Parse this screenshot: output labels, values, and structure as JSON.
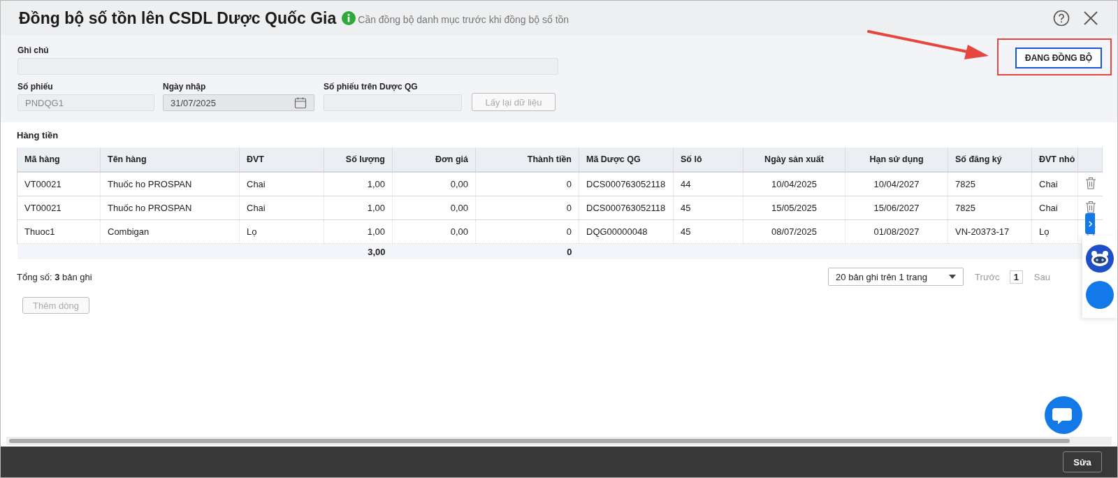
{
  "window": {
    "title": "Đồng bộ số tồn lên CSDL Dược Quốc Gia",
    "hint": "Cần đồng bộ danh mục trước khi đồng bộ số tồn"
  },
  "sync_button": {
    "label": "ĐANG ĐỒNG BỘ"
  },
  "form": {
    "note": {
      "label": "Ghi chú"
    },
    "fields": [
      {
        "kind": "text",
        "label": "Số phiếu",
        "value": "PNDQG1",
        "disabled": true
      },
      {
        "kind": "date",
        "label": "Ngày nhập",
        "value": "31/07/2025",
        "disabled": false
      },
      {
        "kind": "text",
        "label": "Số phiếu trên Dược QG",
        "disabled": true
      }
    ],
    "reload_button": {
      "label": "Lấy lại dữ liệu",
      "disabled": true
    }
  },
  "section_title": "Hàng tiền",
  "table": {
    "columns": [
      "Mã hàng",
      "Tên hàng",
      "ĐVT",
      "Số lượng",
      "Đơn giá",
      "Thành tiền",
      "Mã Dược QG",
      "Số lô",
      "Ngày sản xuất",
      "Hạn sử dụng",
      "Số đăng ký",
      "ĐVT nhỏ"
    ],
    "rows": [
      [
        "VT00021",
        "Thuốc ho PROSPAN",
        "Chai",
        "1,00",
        "0,00",
        "0",
        "DCS000763052118",
        "44",
        "10/04/2025",
        "10/04/2027",
        "7825",
        "Chai"
      ],
      [
        "VT00021",
        "Thuốc ho PROSPAN",
        "Chai",
        "1,00",
        "0,00",
        "0",
        "DCS000763052118",
        "45",
        "15/05/2025",
        "15/06/2027",
        "7825",
        "Chai"
      ],
      [
        "Thuoc1",
        "Combigan",
        "Lọ",
        "1,00",
        "0,00",
        "0",
        "DQG00000048",
        "45",
        "08/07/2025",
        "01/08/2027",
        "VN-20373-17",
        "Lọ"
      ]
    ],
    "totals": {
      "quantity": "3,00",
      "amount": "0"
    }
  },
  "summary": "Tổng số: **3** bản ghi",
  "add_row_button": {
    "label": "Thêm dòng",
    "disabled": true
  },
  "pagination": {
    "page_size": "20 bản ghi trên 1 trang",
    "prev": "Trước",
    "pages": [
      {
        "label": "1",
        "selected": true
      }
    ],
    "next": "Sau"
  },
  "footer": {
    "edit_button": "Sửa"
  }
}
